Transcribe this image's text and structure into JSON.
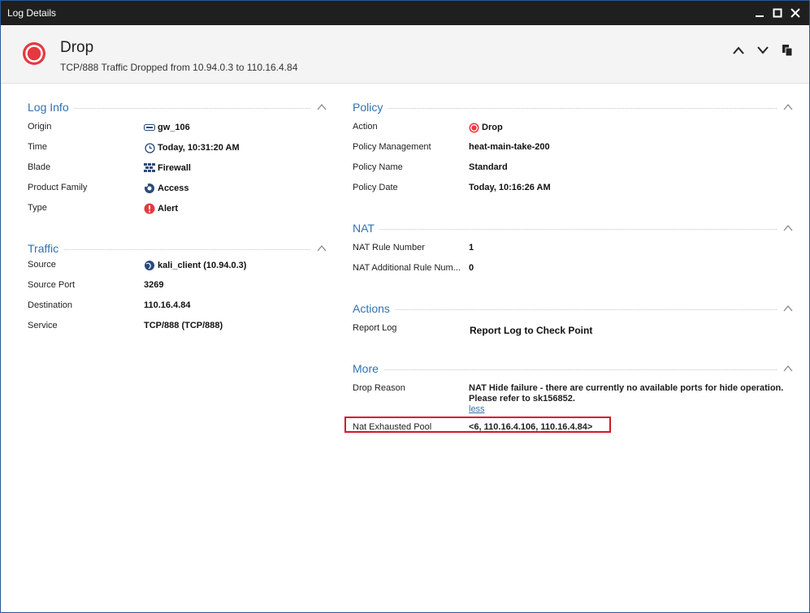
{
  "window": {
    "title": "Log Details"
  },
  "header": {
    "title": "Drop",
    "subtitle": "TCP/888 Traffic Dropped from 10.94.0.3 to 110.16.4.84"
  },
  "log_info": {
    "title": "Log Info",
    "rows": [
      {
        "label": "Origin",
        "value": "gw_106",
        "icon": "gateway-icon"
      },
      {
        "label": "Time",
        "value": "Today, 10:31:20 AM",
        "icon": "clock-icon"
      },
      {
        "label": "Blade",
        "value": "Firewall",
        "icon": "firewall-icon"
      },
      {
        "label": "Product Family",
        "value": "Access",
        "icon": "access-icon"
      },
      {
        "label": "Type",
        "value": "Alert",
        "icon": "alert-icon"
      }
    ]
  },
  "traffic": {
    "title": "Traffic",
    "rows": [
      {
        "label": "Source",
        "value": "kali_client (10.94.0.3)",
        "icon": "globe-icon"
      },
      {
        "label": "Source Port",
        "value": "3269"
      },
      {
        "label": "Destination",
        "value": "110.16.4.84"
      },
      {
        "label": "Service",
        "value": "TCP/888 (TCP/888)"
      }
    ]
  },
  "policy": {
    "title": "Policy",
    "rows": [
      {
        "label": "Action",
        "value": "Drop",
        "icon": "drop-icon"
      },
      {
        "label": "Policy Management",
        "value": "heat-main-take-200"
      },
      {
        "label": "Policy Name",
        "value": "Standard"
      },
      {
        "label": "Policy Date",
        "value": "Today, 10:16:26 AM"
      }
    ]
  },
  "nat": {
    "title": "NAT",
    "rows": [
      {
        "label": "NAT Rule Number",
        "value": "1"
      },
      {
        "label": "NAT Additional Rule Num...",
        "value": "0"
      }
    ]
  },
  "actions": {
    "title": "Actions",
    "rows": [
      {
        "label": "Report Log",
        "value": "Report Log to Check Point"
      }
    ]
  },
  "more": {
    "title": "More",
    "drop_reason_label": "Drop Reason",
    "drop_reason_line1": "NAT Hide failure - there are currently no available ports for hide operation.",
    "drop_reason_line2": "Please refer to sk156852.",
    "less_label": "less",
    "nat_pool_label": "Nat Exhausted Pool",
    "nat_pool_value": "<6, 110.16.4.106, 110.16.4.84>"
  },
  "colors": {
    "accent": "#2f72b5",
    "drop_red": "#e5393f",
    "highlight": "#d6152a"
  }
}
